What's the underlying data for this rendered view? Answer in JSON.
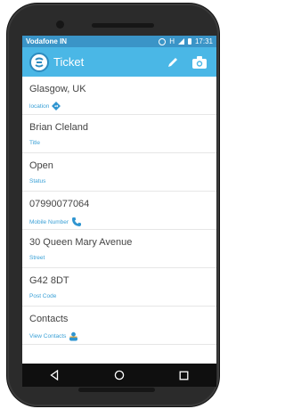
{
  "status_bar": {
    "carrier": "Vodafone IN",
    "network_type": "H",
    "time": "17:31"
  },
  "app_bar": {
    "title": "Ticket",
    "logo_icon": "app-logo-icon",
    "edit_icon": "pencil-icon",
    "camera_icon": "camera-icon"
  },
  "fields": [
    {
      "value": "Glasgow, UK",
      "label": "location",
      "icon": "directions-icon"
    },
    {
      "value": "Brian Cleland",
      "label": "Title",
      "icon": ""
    },
    {
      "value": "Open",
      "label": "Status",
      "icon": ""
    },
    {
      "value": "07990077064",
      "label": "Mobile Number",
      "icon": "phone-icon"
    },
    {
      "value": "30 Queen Mary Avenue",
      "label": "Street",
      "icon": ""
    },
    {
      "value": "G42 8DT",
      "label": "Post Code",
      "icon": ""
    },
    {
      "value": "Contacts",
      "label": "View Contacts",
      "icon": "person-icon"
    }
  ],
  "nav_bar": {
    "back_icon": "back-icon",
    "home_icon": "home-icon",
    "recents_icon": "recents-icon"
  },
  "colors": {
    "status_bar": "#3a94c7",
    "app_bar": "#4ab7e6",
    "label_text": "#3aa0d6",
    "value_text": "#444444",
    "nav_bar": "#0f0f0f",
    "phone_body": "#2b2b2b"
  }
}
